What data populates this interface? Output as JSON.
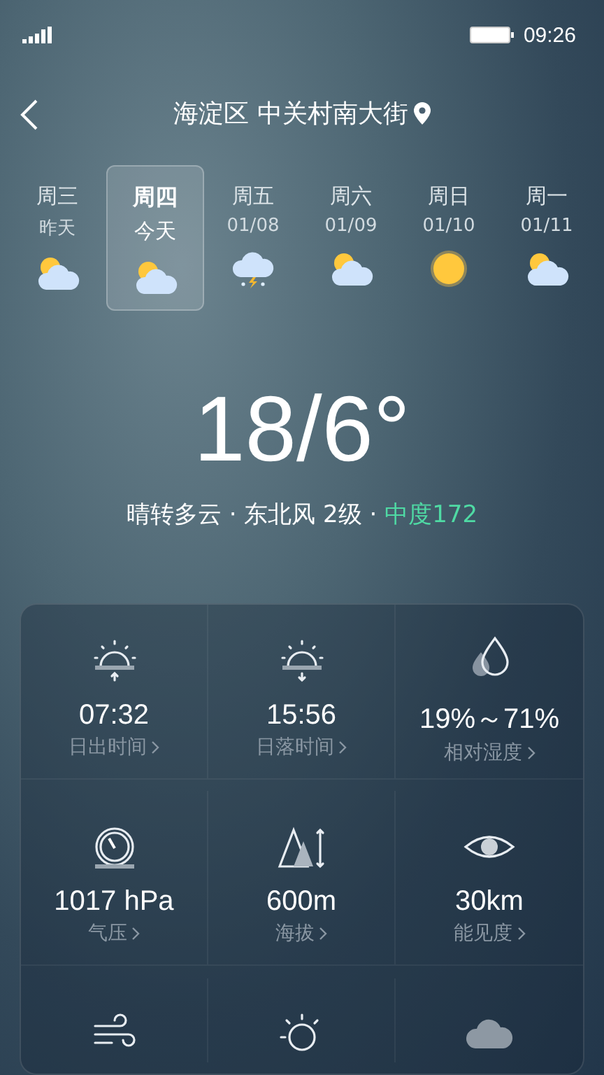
{
  "status_bar": {
    "time": "09:26"
  },
  "header": {
    "location": "海淀区 中关村南大街"
  },
  "days": [
    {
      "weekday": "周三",
      "date": "昨天",
      "kind": "partly_cloudy",
      "selected": false
    },
    {
      "weekday": "周四",
      "date": "今天",
      "kind": "partly_cloudy",
      "selected": true
    },
    {
      "weekday": "周五",
      "date": "01/08",
      "kind": "thunder_snow",
      "selected": false
    },
    {
      "weekday": "周六",
      "date": "01/09",
      "kind": "partly_cloudy",
      "selected": false
    },
    {
      "weekday": "周日",
      "date": "01/10",
      "kind": "sunny",
      "selected": false
    },
    {
      "weekday": "周一",
      "date": "01/11",
      "kind": "partly_cloudy",
      "selected": false
    }
  ],
  "temperature": "18/6°",
  "summary": {
    "weather": "晴转多云 · 东北风 2级 · ",
    "air_quality": "中度172"
  },
  "details": [
    {
      "kind": "sunrise",
      "value": "07:32",
      "label": "日出时间"
    },
    {
      "kind": "sunset",
      "value": "15:56",
      "label": "日落时间"
    },
    {
      "kind": "humidity",
      "value": "19%～71%",
      "label": "相对湿度"
    },
    {
      "kind": "pressure",
      "value": "1017 hPa",
      "label": "气压"
    },
    {
      "kind": "altitude",
      "value": "600m",
      "label": "海拔"
    },
    {
      "kind": "visibility",
      "value": "30km",
      "label": "能见度"
    },
    {
      "kind": "wind"
    },
    {
      "kind": "uv"
    },
    {
      "kind": "cloud"
    }
  ]
}
